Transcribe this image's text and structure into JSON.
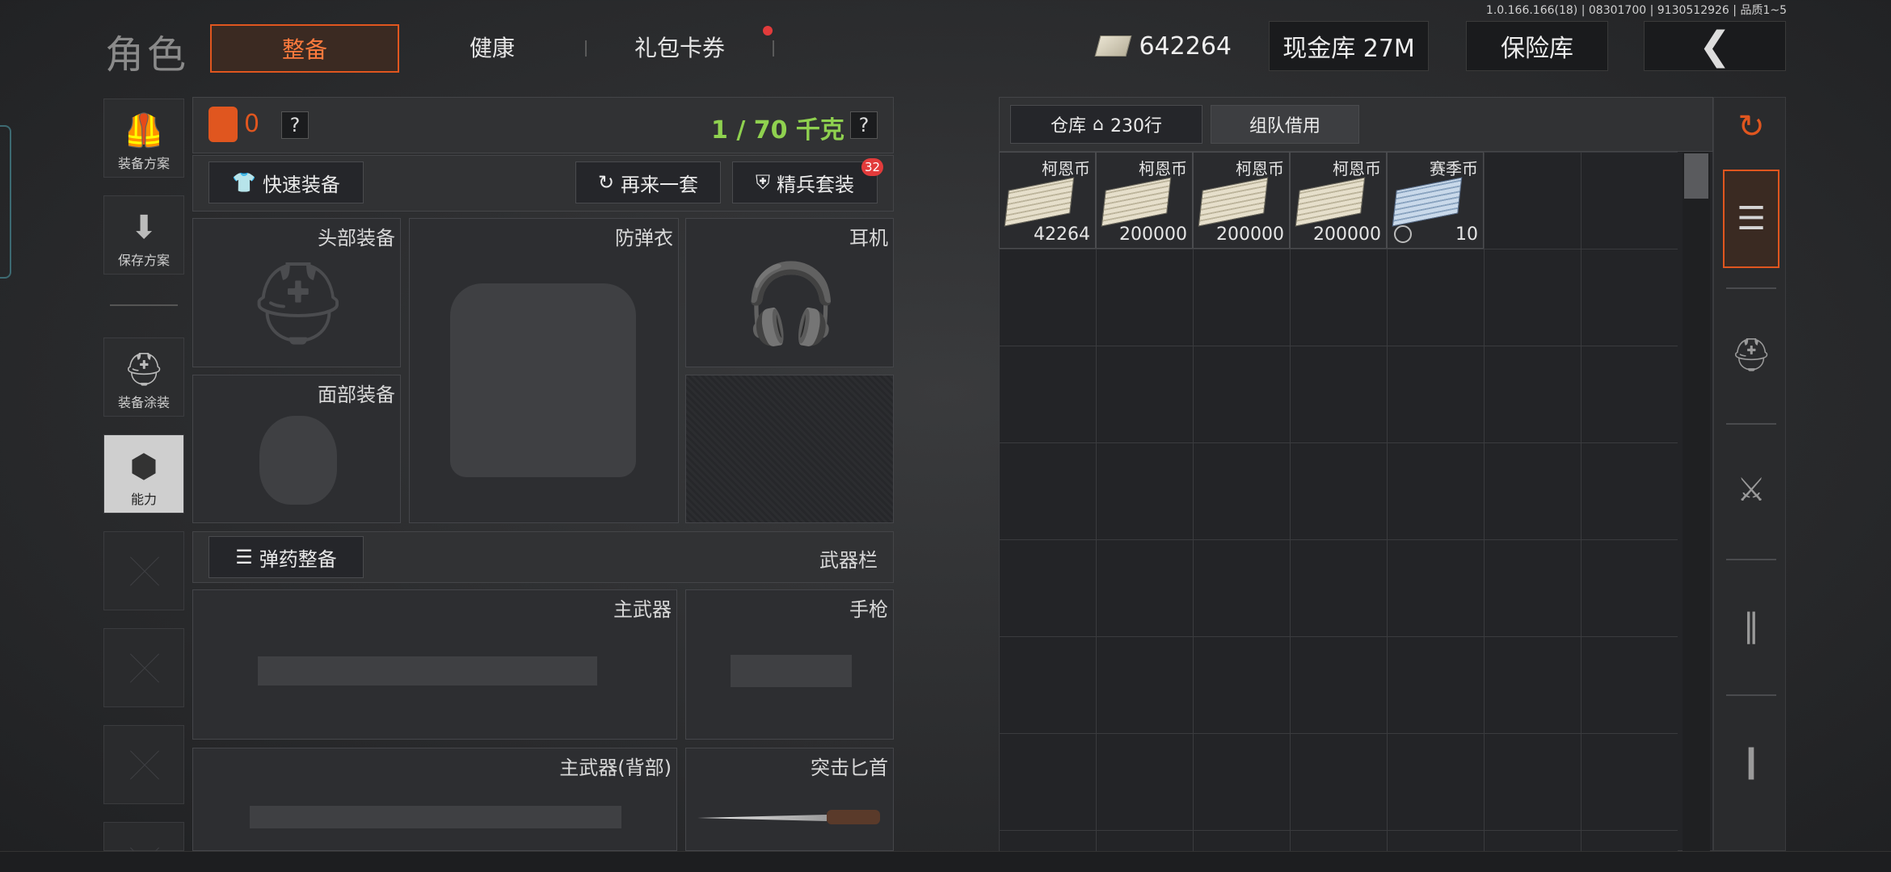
{
  "version_text": "1.0.166.166(18) | 08301700 | 9130512926 | 品质1~5",
  "header": {
    "title": "角色",
    "tabs": [
      {
        "label": "整备",
        "active": true
      },
      {
        "label": "健康",
        "active": false
      },
      {
        "label": "礼包卡券",
        "active": false,
        "has_notification": true
      }
    ],
    "currency_value": "642264",
    "cash_vault_label": "现金库 27M",
    "safe_label": "保险库",
    "back_icon": "chevron-left-icon"
  },
  "sidebar": {
    "items": [
      {
        "label": "装备方案",
        "icon": "vest-icon"
      },
      {
        "label": "保存方案",
        "icon": "download-icon"
      },
      {
        "label": "装备涂装",
        "icon": "helmet-icon"
      },
      {
        "label": "能力",
        "icon": "lightning-hexagon-icon",
        "active": true
      }
    ]
  },
  "equipment": {
    "armor_count": "0",
    "weight": "1 / 70 千克",
    "help": "?",
    "quick_equip": "快速装备",
    "repeat_set": "再来一套",
    "elite_set": "精兵套装",
    "elite_badge": "32",
    "slots": {
      "head": "头部装备",
      "armor": "防弹衣",
      "headset": "耳机",
      "face": "面部装备",
      "ammo_button": "弹药整备",
      "weapon_bar": "武器栏",
      "primary": "主武器",
      "pistol": "手枪",
      "primary_back": "主武器(背部)",
      "knife": "突击匕首"
    }
  },
  "warehouse": {
    "tab_label": "仓库",
    "rows": "230行",
    "team_borrow": "组队借用",
    "items": [
      {
        "name": "柯恩币",
        "count": "42264",
        "type": "cash"
      },
      {
        "name": "柯恩币",
        "count": "200000",
        "type": "cash"
      },
      {
        "name": "柯恩币",
        "count": "200000",
        "type": "cash"
      },
      {
        "name": "柯恩币",
        "count": "200000",
        "type": "cash"
      },
      {
        "name": "赛季币",
        "count": "10",
        "type": "season"
      }
    ]
  },
  "filters": [
    "sort-stack-icon",
    "layers-icon",
    "armor-filter-icon",
    "rifle-filter-icon",
    "magazine-filter-icon",
    "ammo-filter-icon"
  ],
  "colors": {
    "accent": "#e0561f",
    "weight_green": "#8fd14f",
    "notify_red": "#e23b3b"
  }
}
